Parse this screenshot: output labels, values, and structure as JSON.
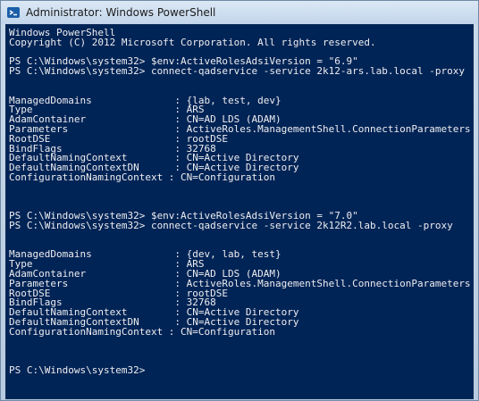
{
  "window": {
    "title": "Administrator: Windows PowerShell",
    "icon": "powershell-icon"
  },
  "console": {
    "lines": [
      "Windows PowerShell",
      "Copyright (C) 2012 Microsoft Corporation. All rights reserved.",
      "",
      "PS C:\\Windows\\system32> $env:ActiveRolesAdsiVersion = \"6.9\"",
      "PS C:\\Windows\\system32> connect-qadservice -service 2k12-ars.lab.local -proxy",
      "",
      "",
      "ManagedDomains              : {lab, test, dev}",
      "Type                        : ARS",
      "AdamContainer               : CN=AD LDS (ADAM)",
      "Parameters                  : ActiveRoles.ManagementShell.ConnectionParameters",
      "RootDSE                     : rootDSE",
      "BindFlags                   : 32768",
      "DefaultNamingContext        : CN=Active Directory",
      "DefaultNamingContextDN      : CN=Active Directory",
      "ConfigurationNamingContext : CN=Configuration",
      "",
      "",
      "",
      "PS C:\\Windows\\system32> $env:ActiveRolesAdsiVersion = \"7.0\"",
      "PS C:\\Windows\\system32> connect-qadservice -service 2k12R2.lab.local -proxy",
      "",
      "",
      "ManagedDomains              : {dev, lab, test}",
      "Type                        : ARS",
      "AdamContainer               : CN=AD LDS (ADAM)",
      "Parameters                  : ActiveRoles.ManagementShell.ConnectionParameters",
      "RootDSE                     : rootDSE",
      "BindFlags                   : 32768",
      "DefaultNamingContext        : CN=Active Directory",
      "DefaultNamingContextDN      : CN=Active Directory",
      "ConfigurationNamingContext : CN=Configuration",
      "",
      "",
      "",
      "PS C:\\Windows\\system32>"
    ]
  },
  "colors": {
    "console_bg": "#012456",
    "console_fg": "#eeedf0"
  }
}
